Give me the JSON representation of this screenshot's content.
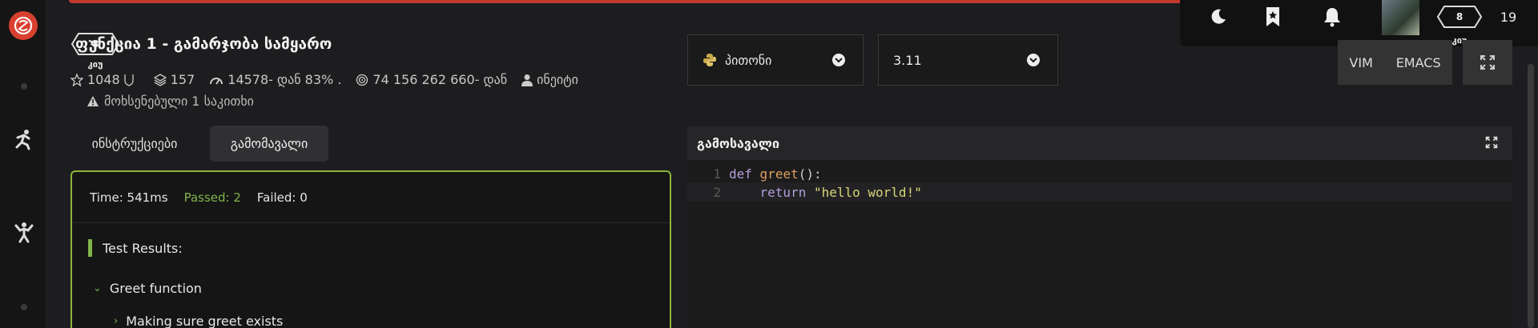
{
  "topbar": {
    "rank": "8",
    "rank_label": "კიუ",
    "honor": "19"
  },
  "kata": {
    "rank": "8",
    "rank_label": "კიუ",
    "title": "ფუნქცია 1 - გამარჯობა სამყარო",
    "stats": {
      "stars": "1048",
      "collections": "157",
      "completed": "14578- დან 83% .",
      "attempts": "74 156 262 660- დან",
      "author": "ინეიტი"
    },
    "issues": "მოხსენებული 1 საკითხი"
  },
  "tabs": {
    "instructions": "ინსტრუქციები",
    "output": "გამომავალი"
  },
  "results": {
    "time": "Time: 541ms",
    "passed": "Passed: 2",
    "failed": "Failed: 0",
    "heading": "Test Results:",
    "group": "Greet function",
    "item": "Making sure greet exists"
  },
  "language": {
    "label": "პითონი"
  },
  "version": {
    "label": "3.11"
  },
  "modes": {
    "vim": "VIM",
    "emacs": "EMACS"
  },
  "output_panel": {
    "title": "გამოსავალი"
  },
  "editor": {
    "lines": [
      {
        "num": "1",
        "kw": "def",
        "fn": "greet",
        "rest": "():"
      },
      {
        "num": "2",
        "kw": "return",
        "str": "\"hello world!\""
      }
    ]
  },
  "colors": {
    "accent_green": "#7fb54a",
    "brand_red": "#d8402f",
    "panel_border": "#8ab539"
  }
}
